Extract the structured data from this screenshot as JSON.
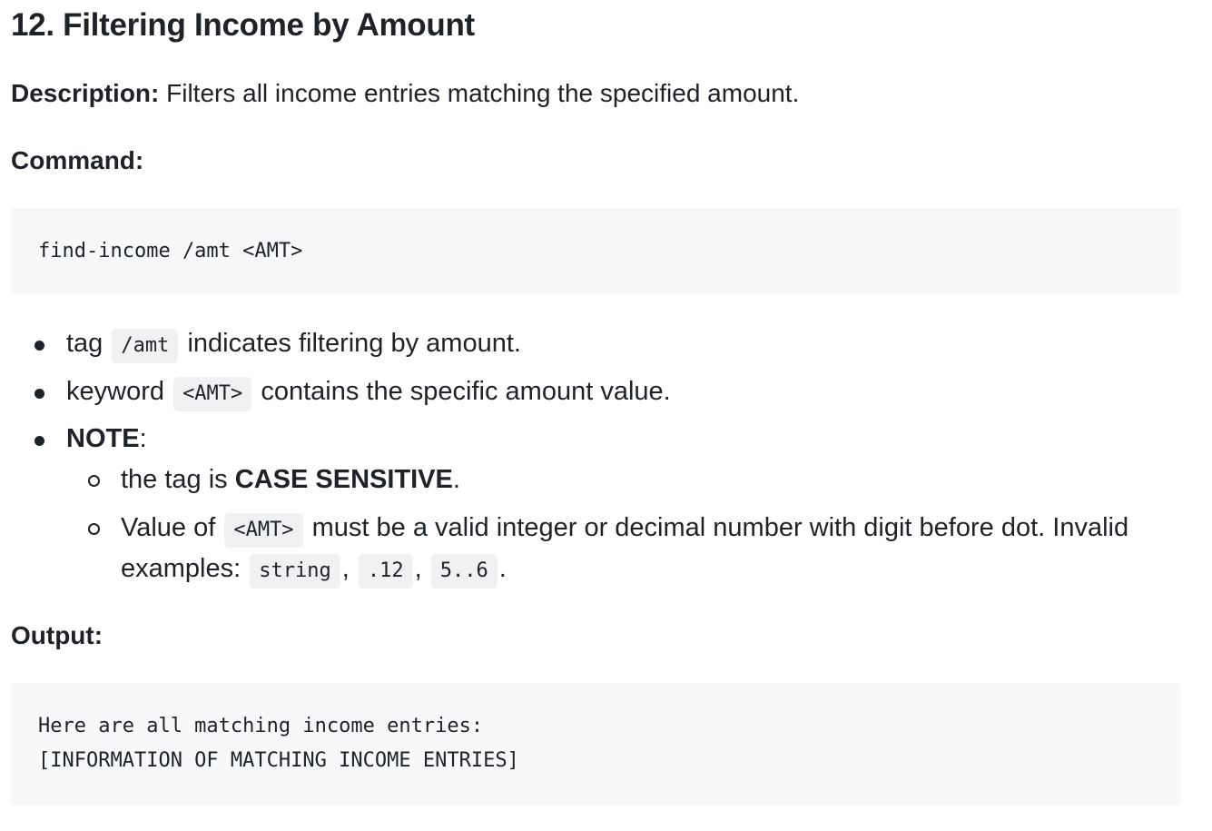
{
  "heading": "12. Filtering Income by Amount",
  "description": {
    "label": "Description:",
    "text": " Filters all income entries matching the specified amount."
  },
  "command": {
    "label": "Command:",
    "code": "find-income /amt <AMT>"
  },
  "bullets": {
    "tag": {
      "prefix": "tag",
      "code": "/amt",
      "suffix": "indicates filtering by amount."
    },
    "keyword": {
      "prefix": "keyword",
      "code": "<AMT>",
      "suffix": "contains the specific amount value."
    },
    "note": {
      "label": "NOTE",
      "colon": ":",
      "sub_items": {
        "case": {
          "prefix": "the tag is ",
          "strong": "CASE SENSITIVE",
          "suffix": "."
        },
        "value": {
          "prefix": "Value of",
          "code": "<AMT>",
          "suffix": "must be a valid integer or decimal number with digit before dot. Invalid",
          "line2_prefix": "examples:",
          "examples": [
            "string",
            ".12",
            "5..6"
          ],
          "separator": ",",
          "end": "."
        }
      }
    }
  },
  "output": {
    "label": "Output:",
    "lines": [
      "Here are all matching income entries:",
      "[INFORMATION OF MATCHING INCOME ENTRIES]"
    ]
  }
}
